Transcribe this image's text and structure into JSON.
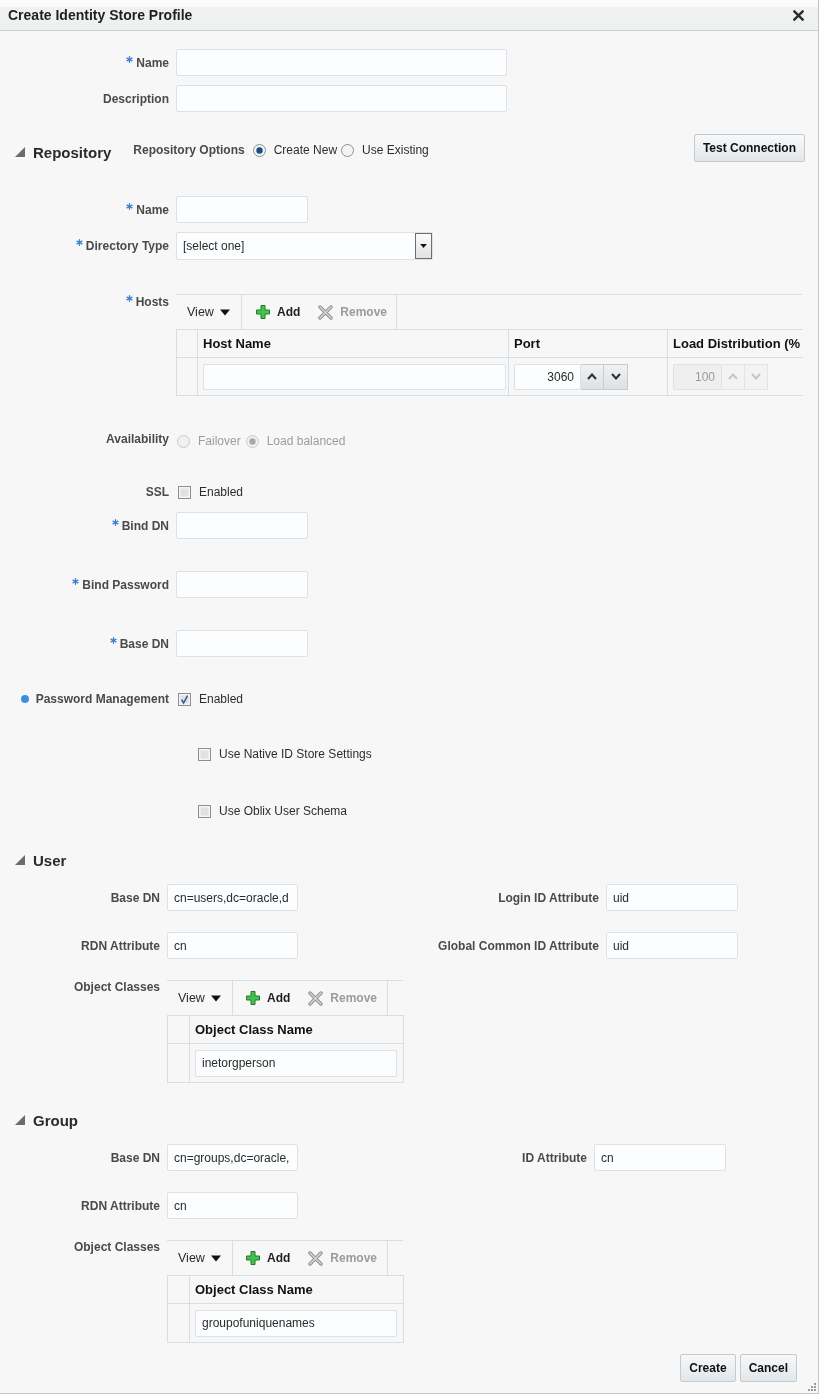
{
  "dialog": {
    "title": "Create Identity Store Profile"
  },
  "profile": {
    "fields": [
      {
        "label": "Name",
        "required": true
      },
      {
        "label": "Description",
        "required": false
      }
    ]
  },
  "repository": {
    "title": "Repository",
    "expanded": true,
    "options_label": "Repository Options",
    "options": [
      {
        "label": "Create New",
        "selected": true
      },
      {
        "label": "Use Existing",
        "selected": false
      }
    ],
    "test_button": "Test Connection",
    "name": {
      "label": "Name",
      "required": true
    },
    "directory_type": {
      "label": "Directory Type",
      "required": true,
      "value": "[select one]"
    },
    "hosts": {
      "label": "Hosts",
      "required": true,
      "toolbar": {
        "view": "View",
        "actions": [
          {
            "kind": "add",
            "label": "Add",
            "disabled": false
          },
          {
            "kind": "remove",
            "label": "Remove",
            "disabled": true
          }
        ]
      },
      "columns": [
        "Host Name",
        "Port",
        "Load Distribution (%"
      ],
      "rows": [
        {
          "port": "3060",
          "load_distribution": "100",
          "load_disabled": true
        }
      ]
    },
    "availability": {
      "label": "Availability",
      "disabled": true,
      "options": [
        {
          "label": "Failover",
          "selected": false
        },
        {
          "label": "Load balanced",
          "selected": true
        }
      ]
    },
    "ssl": {
      "label": "SSL",
      "option": "Enabled",
      "checked": false
    },
    "credentials": [
      {
        "label": "Bind DN",
        "required": true
      },
      {
        "label": "Bind Password",
        "required": true
      },
      {
        "label": "Base DN",
        "required": true
      }
    ],
    "password_management": {
      "label": "Password Management",
      "changed": true,
      "option": "Enabled",
      "checked": true,
      "settings": [
        {
          "label": "Use Native ID Store Settings",
          "checked": false
        },
        {
          "label": "Use Oblix User Schema",
          "checked": false
        }
      ]
    }
  },
  "user": {
    "title": "User",
    "expanded": true,
    "rows": [
      {
        "left": {
          "label": "Base DN",
          "value": "cn=users,dc=oracle,d"
        },
        "right": {
          "label": "Login ID Attribute",
          "value": "uid"
        }
      },
      {
        "left": {
          "label": "RDN Attribute",
          "value": "cn"
        },
        "right": {
          "label": "Global Common ID Attribute",
          "value": "uid"
        }
      }
    ],
    "object_classes": {
      "label": "Object Classes",
      "toolbar": {
        "view": "View",
        "actions": [
          {
            "kind": "add",
            "label": "Add",
            "disabled": false
          },
          {
            "kind": "remove",
            "label": "Remove",
            "disabled": true
          }
        ]
      },
      "column": "Object Class Name",
      "rows": [
        "inetorgperson"
      ]
    }
  },
  "group": {
    "title": "Group",
    "expanded": true,
    "rows": [
      {
        "left": {
          "label": "Base DN",
          "value": "cn=groups,dc=oracle,"
        },
        "right": {
          "label": "ID Attribute",
          "value": "cn"
        }
      },
      {
        "left": {
          "label": "RDN Attribute",
          "value": "cn"
        }
      }
    ],
    "object_classes": {
      "label": "Object Classes",
      "toolbar": {
        "view": "View",
        "actions": [
          {
            "kind": "add",
            "label": "Add",
            "disabled": false
          },
          {
            "kind": "remove",
            "label": "Remove",
            "disabled": true
          }
        ]
      },
      "column": "Object Class Name",
      "rows": [
        "groupofuniquenames"
      ]
    }
  },
  "buttons": [
    "Create",
    "Cancel"
  ]
}
